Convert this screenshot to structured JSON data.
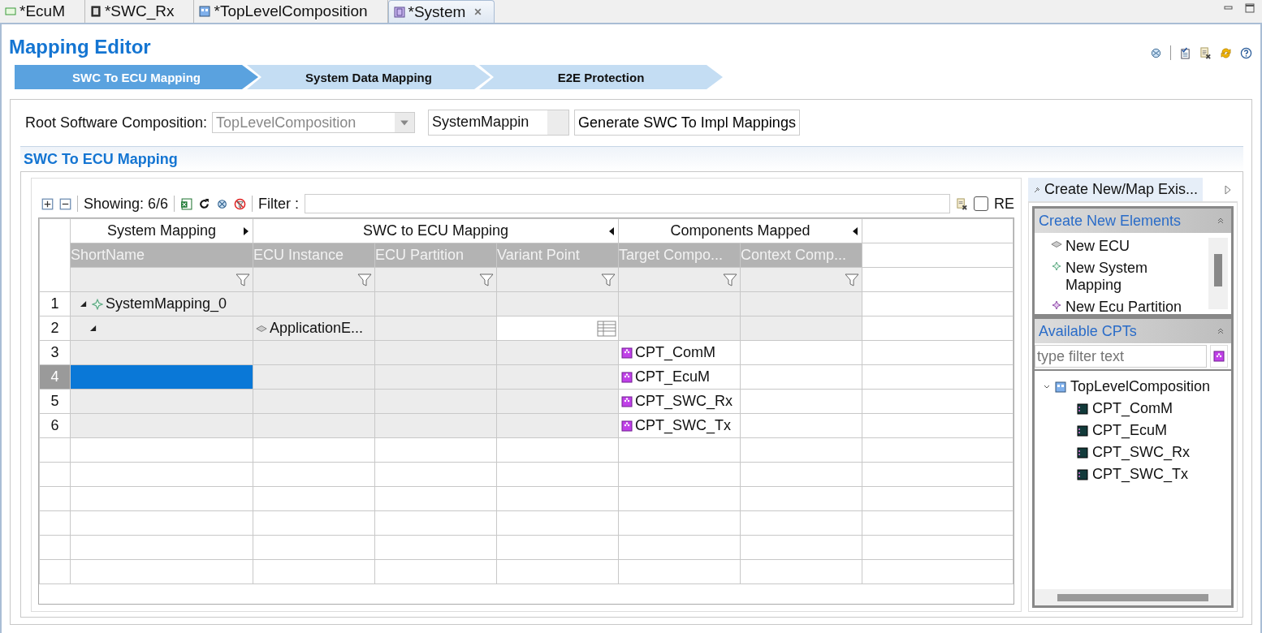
{
  "editor_tabs": [
    {
      "label": "*EcuM",
      "selected": false,
      "kind": "module"
    },
    {
      "label": "*SWC_Rx",
      "selected": false,
      "kind": "swc"
    },
    {
      "label": "*TopLevelComposition",
      "selected": false,
      "kind": "composition"
    },
    {
      "label": "*System",
      "selected": true,
      "kind": "system"
    }
  ],
  "title": "Mapping Editor",
  "steps": [
    {
      "label": "SWC To ECU Mapping",
      "selected": true
    },
    {
      "label": "System Data Mapping",
      "selected": false
    },
    {
      "label": "E2E Protection",
      "selected": false
    }
  ],
  "root_composition": {
    "label": "Root Software Composition:",
    "value": "TopLevelComposition"
  },
  "mapping_name": "SystemMappin",
  "generate_button": "Generate SWC To Impl Mappings",
  "section_title": "SWC To ECU Mapping",
  "toolbar": {
    "showing": "Showing: 6/6",
    "filter_label": "Filter :",
    "re": {
      "label": "RE",
      "checked": false
    }
  },
  "table": {
    "groups": [
      {
        "label": "System Mapping",
        "collapsed": true,
        "columns": [
          "ShortName"
        ]
      },
      {
        "label": "SWC to ECU Mapping",
        "collapsed": false,
        "columns": [
          "ECU Instance",
          "ECU Partition",
          "Variant Point"
        ]
      },
      {
        "label": "Components Mapped",
        "collapsed": false,
        "columns": [
          "Target Compo...",
          "Context Comp..."
        ]
      }
    ],
    "rows": [
      {
        "number": "1",
        "selected": false,
        "expanded": true,
        "short_name": "SystemMapping_0",
        "children": [
          {
            "number": "2",
            "selected": false,
            "expanded": true,
            "ecu_instance": "ApplicationE...",
            "variant_editor": true,
            "children": [
              {
                "number": "3",
                "selected": false,
                "target_component": "CPT_ComM"
              },
              {
                "number": "4",
                "selected": true,
                "target_component": "CPT_EcuM"
              },
              {
                "number": "5",
                "selected": false,
                "target_component": "CPT_SWC_Rx"
              },
              {
                "number": "6",
                "selected": false,
                "target_component": "CPT_SWC_Tx"
              }
            ]
          }
        ]
      }
    ]
  },
  "side_panel": {
    "tab": "Create New/Map Exis...",
    "create_section": {
      "title": "Create New Elements",
      "items": [
        {
          "label": "New ECU",
          "kind": "ecu"
        },
        {
          "label": "New System Mapping",
          "kind": "mapping"
        },
        {
          "label": "New Ecu Partition",
          "kind": "partition"
        }
      ]
    },
    "cpt_section": {
      "title": "Available CPTs",
      "filter_placeholder": "type filter text",
      "tree": [
        {
          "label": "TopLevelComposition",
          "expanded": true,
          "children": [
            {
              "label": "CPT_ComM"
            },
            {
              "label": "CPT_EcuM"
            },
            {
              "label": "CPT_SWC_Rx"
            },
            {
              "label": "CPT_SWC_Tx"
            }
          ]
        }
      ]
    }
  }
}
